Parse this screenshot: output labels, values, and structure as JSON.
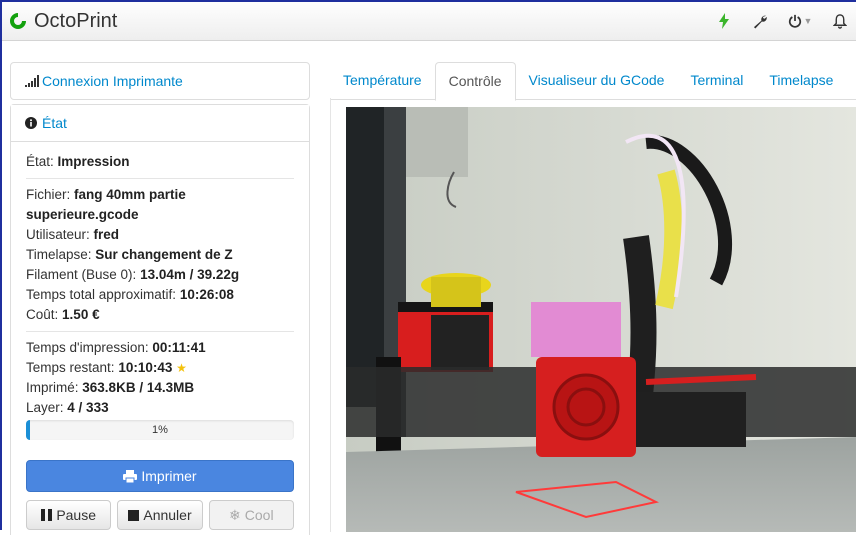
{
  "brand": {
    "name": "OctoPrint"
  },
  "navbar": {
    "icons": [
      "bolt-icon",
      "wrench-icon",
      "power-icon",
      "bell-icon"
    ]
  },
  "connection": {
    "title": "Connexion Imprimante"
  },
  "state": {
    "title": "État",
    "status_label": "État:",
    "status_value": "Impression",
    "file_label": "Fichier:",
    "file_value": "fang 40mm partie superieure.gcode",
    "user_label": "Utilisateur:",
    "user_value": "fred",
    "timelapse_label": "Timelapse:",
    "timelapse_value": "Sur changement de Z",
    "filament_label": "Filament (Buse 0):",
    "filament_value": "13.04m / 39.22g",
    "total_time_label": "Temps total approximatif:",
    "total_time_value": "10:26:08",
    "cost_label": "Coût:",
    "cost_value": "1.50 €",
    "print_time_label": "Temps d'impression:",
    "print_time_value": "00:11:41",
    "remaining_label": "Temps restant:",
    "remaining_value": "10:10:43",
    "printed_label": "Imprimé:",
    "printed_value": "363.8KB / 14.3MB",
    "layer_label": "Layer:",
    "layer_value": "4 / 333",
    "progress_text": "1%",
    "progress_fraction": 0.01
  },
  "buttons": {
    "print": "Imprimer",
    "pause": "Pause",
    "cancel": "Annuler",
    "cool": "Cool"
  },
  "tabs": [
    {
      "label": "Température",
      "active": false
    },
    {
      "label": "Contrôle",
      "active": true
    },
    {
      "label": "Visualiseur du GCode",
      "active": false
    },
    {
      "label": "Terminal",
      "active": false
    },
    {
      "label": "Timelapse",
      "active": false
    }
  ],
  "colors": {
    "accent": "#0088cc",
    "primary_button": "#4a86e0",
    "progress": "#1b8fd6",
    "active_icon": "#3bb52c"
  }
}
